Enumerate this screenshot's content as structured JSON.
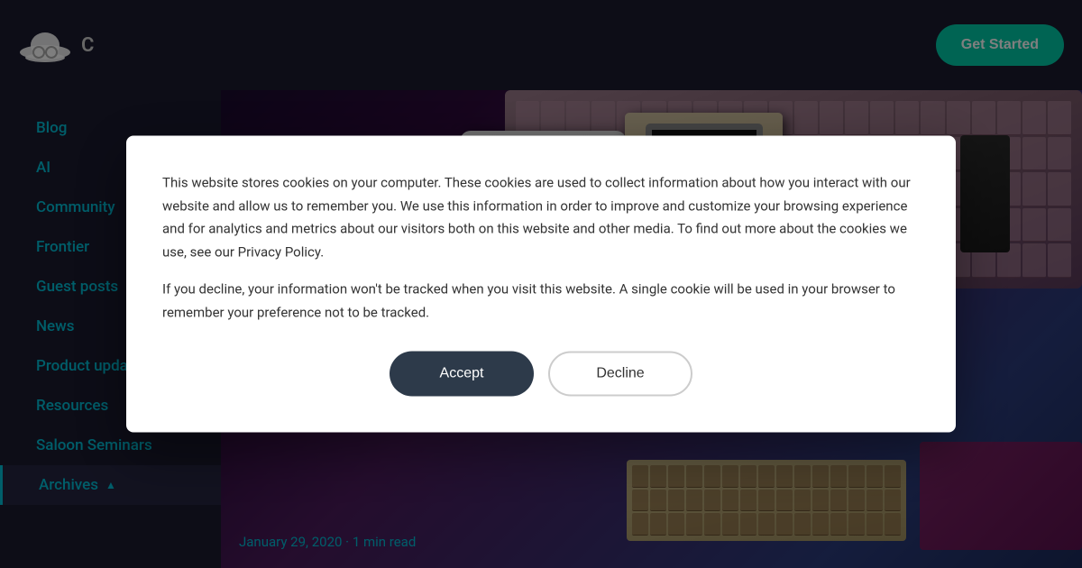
{
  "header": {
    "logo_alt": "Cowboy hat logo",
    "logo_initial": "C",
    "get_started_label": "Get Started"
  },
  "sidebar": {
    "items": [
      {
        "label": "Blog",
        "href": "#"
      },
      {
        "label": "AI",
        "href": "#"
      },
      {
        "label": "Community",
        "href": "#"
      },
      {
        "label": "Frontier",
        "href": "#"
      },
      {
        "label": "Guest posts",
        "href": "#"
      },
      {
        "label": "News",
        "href": "#"
      },
      {
        "label": "Product updates",
        "href": "#"
      },
      {
        "label": "Resources",
        "href": "#"
      },
      {
        "label": "Saloon Seminars",
        "href": "#"
      }
    ],
    "archives_label": "Archives",
    "archives_expanded": true
  },
  "article": {
    "date": "January 29, 2020",
    "read_time": "1 min read",
    "date_separator": "·"
  },
  "cookie_modal": {
    "body_text_1": "This website stores cookies on your computer. These cookies are used to collect information about how you interact with our website and allow us to remember you. We use this information in order to improve and customize your browsing experience and for analytics and metrics about our visitors both on this website and other media. To find out more about the cookies we use, see our Privacy Policy.",
    "body_text_2": "If you decline, your information won't be tracked when you visit this website. A single cookie will be used in your browser to remember your preference not to be tracked.",
    "accept_label": "Accept",
    "decline_label": "Decline"
  },
  "colors": {
    "accent": "#00bcd4",
    "get_started_bg": "#00c9a7",
    "dark_bg": "#1a1a2e",
    "modal_bg": "#ffffff"
  }
}
